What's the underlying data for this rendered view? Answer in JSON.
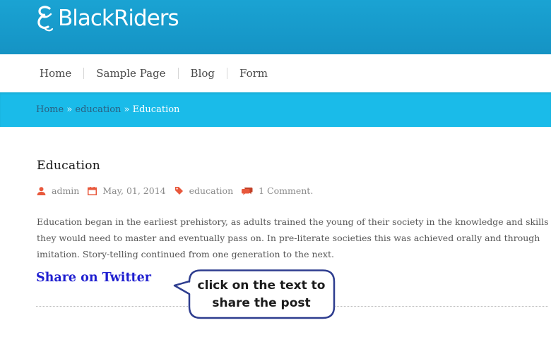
{
  "site": {
    "logo_black": "Black",
    "logo_riders": "Riders"
  },
  "nav": {
    "items": [
      {
        "label": "Home"
      },
      {
        "label": "Sample Page"
      },
      {
        "label": "Blog"
      },
      {
        "label": "Form"
      }
    ]
  },
  "breadcrumb": {
    "home": "Home",
    "sep1": " » ",
    "category": "education",
    "sep2": " » ",
    "current": "Education"
  },
  "post": {
    "title": "Education",
    "author": "admin",
    "date": "May, 01, 2014",
    "category": "education",
    "comments": "1 Comment.",
    "excerpt": "Education began in the earliest prehistory, as adults trained the young of their society in the knowledge and skills they would need to master and eventually pass on. In pre-literate societies this was achieved orally and through imitation. Story-telling continued from one generation to the next.",
    "share_label": "Share on Twitter"
  },
  "callout": {
    "line1": "click on the text to",
    "line2": "share the post"
  },
  "colors": {
    "header": "#1aa3d3",
    "breadcrumb_bar": "#1abbe9",
    "meta_icon": "#e8583c",
    "share_link": "#1f1fd0",
    "callout_border": "#2e3d8f"
  },
  "icons": {
    "logo": "logo-mark-icon",
    "author": "user-icon",
    "date": "calendar-icon",
    "category": "tag-icon",
    "comments": "comments-icon"
  }
}
